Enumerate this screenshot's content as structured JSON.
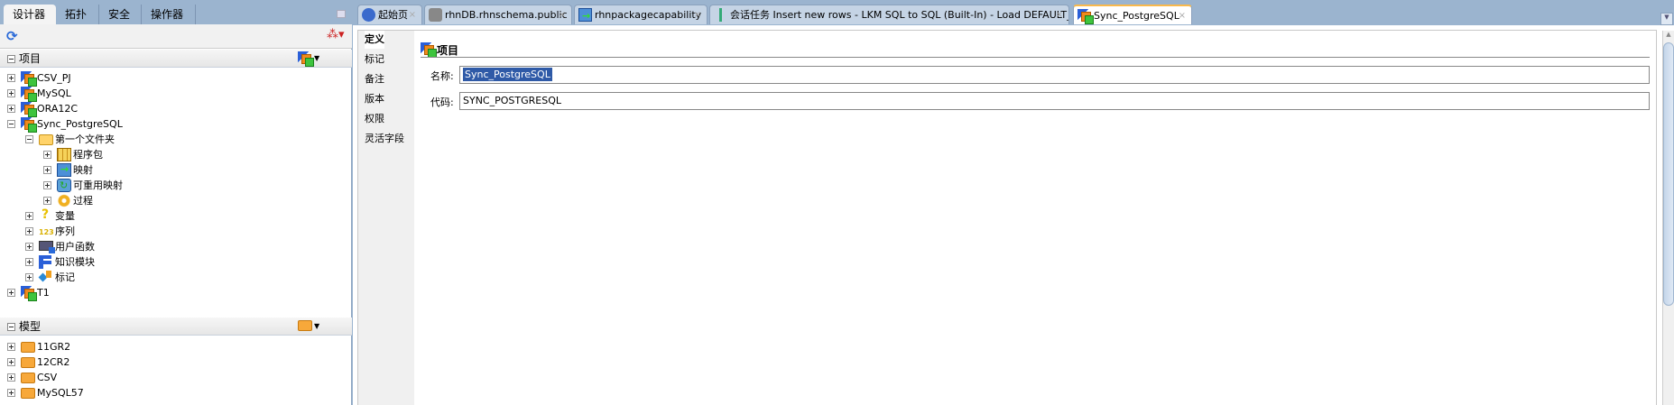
{
  "left_tabs": [
    {
      "label": "设计器",
      "close": "×"
    },
    {
      "label": "拓扑"
    },
    {
      "label": "安全"
    },
    {
      "label": "操作器"
    }
  ],
  "projects": {
    "title": "项目",
    "tree": [
      {
        "label": "CSV_PJ",
        "level": 0,
        "icon": "proj",
        "exp": "plus"
      },
      {
        "label": "MySQL",
        "level": 0,
        "icon": "proj",
        "exp": "plus"
      },
      {
        "label": "ORA12C",
        "level": 0,
        "icon": "proj",
        "exp": "plus"
      },
      {
        "label": "Sync_PostgreSQL",
        "level": 0,
        "icon": "proj",
        "exp": "minus"
      },
      {
        "label": "第一个文件夹",
        "level": 1,
        "icon": "ofolder",
        "exp": "minus"
      },
      {
        "label": "程序包",
        "level": 2,
        "icon": "pkg",
        "exp": "plus"
      },
      {
        "label": "映射",
        "level": 2,
        "icon": "map",
        "exp": "plus"
      },
      {
        "label": "可重用映射",
        "level": 2,
        "icon": "rmap",
        "exp": "plus"
      },
      {
        "label": "过程",
        "level": 2,
        "icon": "gear",
        "exp": "plus"
      },
      {
        "label": "变量",
        "level": 1,
        "icon": "var",
        "exp": "plus"
      },
      {
        "label": "序列",
        "level": 1,
        "icon": "seq",
        "exp": "plus"
      },
      {
        "label": "用户函数",
        "level": 1,
        "icon": "func",
        "exp": "plus"
      },
      {
        "label": "知识模块",
        "level": 1,
        "icon": "km",
        "exp": "plus"
      },
      {
        "label": "标记",
        "level": 1,
        "icon": "tag",
        "exp": "plus"
      },
      {
        "label": "T1",
        "level": 0,
        "icon": "proj",
        "exp": "plus"
      }
    ]
  },
  "models": {
    "title": "模型",
    "tree": [
      {
        "label": "11GR2",
        "level": 0,
        "icon": "folder",
        "exp": "plus"
      },
      {
        "label": "12CR2",
        "level": 0,
        "icon": "folder",
        "exp": "plus"
      },
      {
        "label": "CSV",
        "level": 0,
        "icon": "folder",
        "exp": "plus"
      },
      {
        "label": "MySQL57",
        "level": 0,
        "icon": "folder",
        "exp": "plus"
      }
    ]
  },
  "editor_tabs": [
    {
      "label": "起始页",
      "icon": "help"
    },
    {
      "label": "rhnDB.rhnschema.public",
      "icon": "db"
    },
    {
      "label": "rhnpackagecapability",
      "icon": "map"
    },
    {
      "label": "会话任务 Insert new rows - LKM SQL to SQL (Built-In) - Load DEFAULT_AP",
      "icon": "task"
    },
    {
      "label": "Sync_PostgreSQL",
      "icon": "proj",
      "active": true
    }
  ],
  "close_glyph": "×",
  "nav": [
    "定义",
    "标记",
    "备注",
    "版本",
    "权限",
    "灵活字段"
  ],
  "form": {
    "title": "项目",
    "name_label": "名称:",
    "name_value": "Sync_PostgreSQL",
    "code_label": "代码:",
    "code_value": "SYNC_POSTGRESQL"
  }
}
